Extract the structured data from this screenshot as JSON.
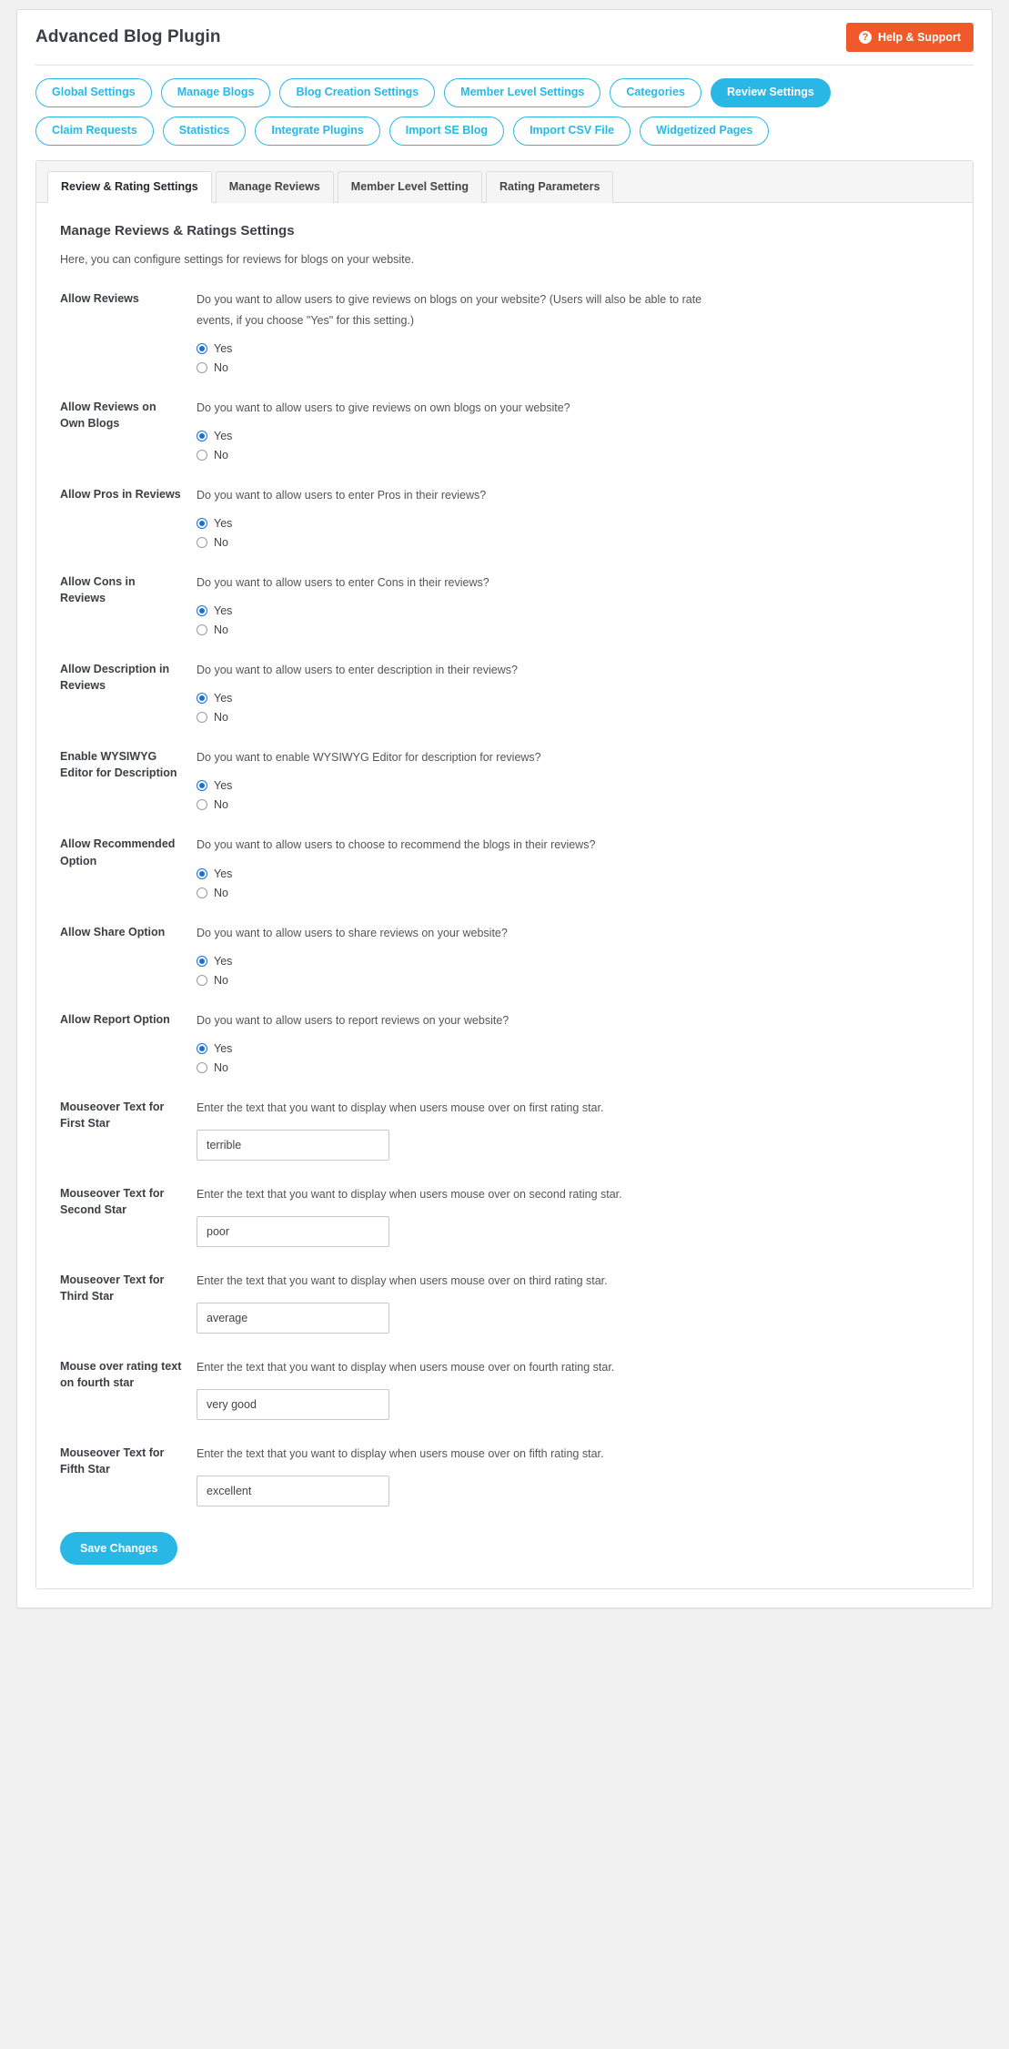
{
  "header": {
    "title": "Advanced Blog Plugin",
    "help_button": "Help & Support",
    "help_icon": "question-circle-icon"
  },
  "nav": {
    "row1": [
      {
        "label": "Global Settings",
        "active": false
      },
      {
        "label": "Manage Blogs",
        "active": false
      },
      {
        "label": "Blog Creation Settings",
        "active": false
      },
      {
        "label": "Member Level Settings",
        "active": false
      },
      {
        "label": "Categories",
        "active": false
      },
      {
        "label": "Review Settings",
        "active": true
      }
    ],
    "row2": [
      {
        "label": "Claim Requests",
        "active": false
      },
      {
        "label": "Statistics",
        "active": false
      },
      {
        "label": "Integrate Plugins",
        "active": false
      },
      {
        "label": "Import SE Blog",
        "active": false
      },
      {
        "label": "Import CSV File",
        "active": false
      },
      {
        "label": "Widgetized Pages",
        "active": false
      }
    ]
  },
  "tabs": [
    {
      "label": "Review & Rating Settings",
      "active": true
    },
    {
      "label": "Manage Reviews",
      "active": false
    },
    {
      "label": "Member Level Setting",
      "active": false
    },
    {
      "label": "Rating Parameters",
      "active": false
    }
  ],
  "content": {
    "section_title": "Manage Reviews & Ratings Settings",
    "section_sub": "Here, you can configure settings for reviews for blogs on your website.",
    "yes_label": "Yes",
    "no_label": "No",
    "save_label": "Save Changes"
  },
  "settings": [
    {
      "label": "Allow Reviews",
      "description": "Do you want to allow users to give reviews on blogs on your website? (Users will also be able to rate events, if you choose \"Yes\" for this setting.)",
      "type": "radio",
      "value": "Yes"
    },
    {
      "label": "Allow Reviews on Own Blogs",
      "description": "Do you want to allow users to give reviews on own blogs on your website?",
      "type": "radio",
      "value": "Yes"
    },
    {
      "label": "Allow Pros in Reviews",
      "description": "Do you want to allow users to enter Pros in their reviews?",
      "type": "radio",
      "value": "Yes"
    },
    {
      "label": "Allow Cons in Reviews",
      "description": "Do you want to allow users to enter Cons in their reviews?",
      "type": "radio",
      "value": "Yes"
    },
    {
      "label": "Allow Description in Reviews",
      "description": "Do you want to allow users to enter description in their reviews?",
      "type": "radio",
      "value": "Yes"
    },
    {
      "label": "Enable WYSIWYG Editor for Description",
      "description": "Do you want to enable WYSIWYG Editor for description for reviews?",
      "type": "radio",
      "value": "Yes"
    },
    {
      "label": "Allow Recommended Option",
      "description": "Do you want to allow users to choose to recommend the blogs in their reviews?",
      "type": "radio",
      "value": "Yes"
    },
    {
      "label": "Allow Share Option",
      "description": "Do you want to allow users to share reviews on your website?",
      "type": "radio",
      "value": "Yes"
    },
    {
      "label": "Allow Report Option",
      "description": "Do you want to allow users to report reviews on your website?",
      "type": "radio",
      "value": "Yes"
    },
    {
      "label": "Mouseover Text for First Star",
      "description": "Enter the text that you want to display when users mouse over on first rating star.",
      "type": "text",
      "value": "terrible"
    },
    {
      "label": "Mouseover Text for Second Star",
      "description": "Enter the text that you want to display when users mouse over on second rating star.",
      "type": "text",
      "value": "poor"
    },
    {
      "label": "Mouseover Text for Third Star",
      "description": "Enter the text that you want to display when users mouse over on third rating star.",
      "type": "text",
      "value": "average"
    },
    {
      "label": "Mouse over rating text on fourth star",
      "description": "Enter the text that you want to display when users mouse over on fourth rating star.",
      "type": "text",
      "value": "very good"
    },
    {
      "label": "Mouseover Text for Fifth Star",
      "description": "Enter the text that you want to display when users mouse over on fifth rating star.",
      "type": "text",
      "value": "excellent"
    }
  ],
  "colors": {
    "accent": "#29b8e5",
    "help": "#f1592a",
    "radio_selected": "#1a6fd4"
  }
}
